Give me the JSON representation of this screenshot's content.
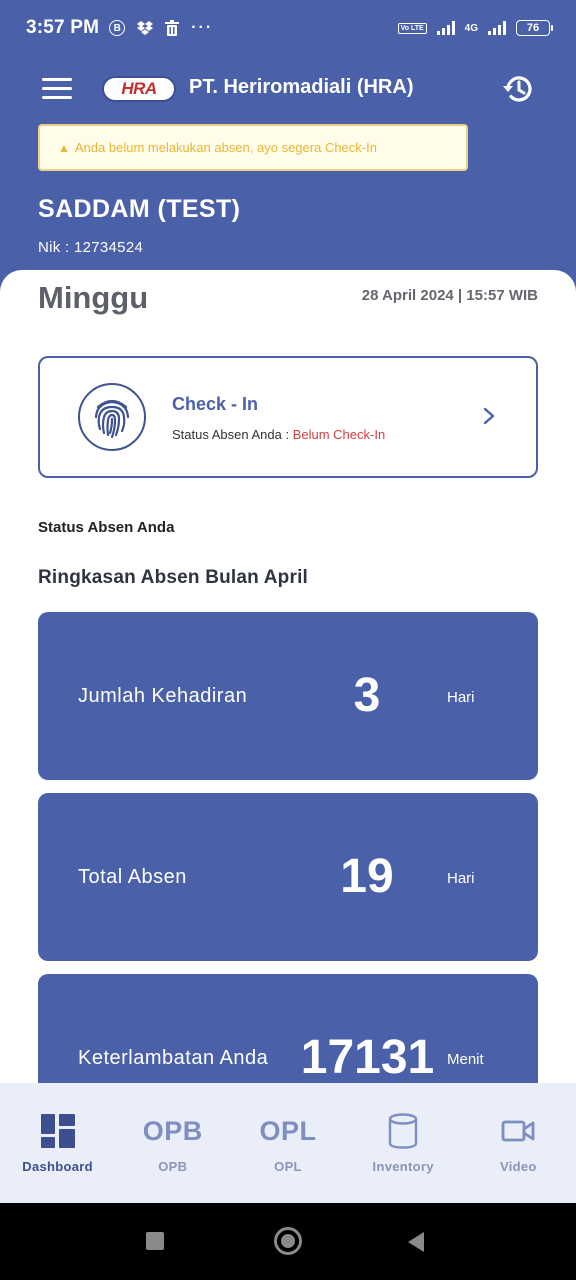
{
  "status_bar": {
    "time": "3:57 PM",
    "b_badge": "B",
    "network": "4G",
    "volte": "Vo LTE",
    "battery": "76"
  },
  "header": {
    "company": "PT. Heriromadiali (HRA)",
    "logo_text": "HRA"
  },
  "alert": {
    "icon": "warning-icon",
    "text": "Anda belum melakukan absen, ayo segera Check-In",
    "color": "#e9b635"
  },
  "user": {
    "name": "SADDAM (TEST)",
    "nik": "Nik : 12734524"
  },
  "date": {
    "day": "Minggu",
    "datetime": "28 April 2024 | 15:57 WIB"
  },
  "checkin": {
    "title": "Check - In",
    "status_label": "Status Absen Anda : ",
    "status_value": "Belum Check-In"
  },
  "sections": {
    "status_title": "Status Absen Anda",
    "summary_title": "Ringkasan Absen Bulan April"
  },
  "stats": [
    {
      "label": "Jumlah Kehadiran",
      "value": "3",
      "unit": "Hari"
    },
    {
      "label": "Total Absen",
      "value": "19",
      "unit": "Hari"
    },
    {
      "label": "Keterlambatan Anda",
      "value": "17131",
      "unit": "Menit"
    }
  ],
  "nav": [
    {
      "label": "Dashboard",
      "icon": "dashboard-grid-icon",
      "active": true
    },
    {
      "label": "OPB",
      "icon_text": "OPB"
    },
    {
      "label": "OPL",
      "icon_text": "OPL"
    },
    {
      "label": "Inventory",
      "icon": "database-icon"
    },
    {
      "label": "Video",
      "icon": "video-camera-icon"
    }
  ],
  "colors": {
    "primary": "#4a60a8",
    "danger": "#d04040",
    "nav_bg": "#e9eef9"
  }
}
